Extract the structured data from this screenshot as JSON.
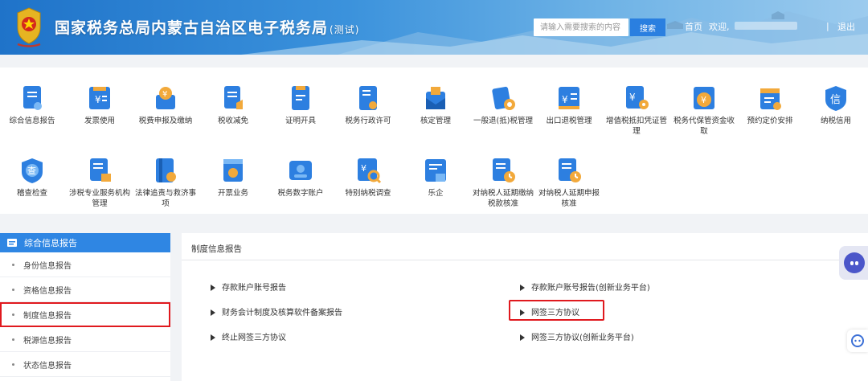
{
  "header": {
    "title": "国家税务总局内蒙古自治区电子税务局",
    "title_suffix": "(测试)",
    "search_placeholder": "请输入需要搜索的内容",
    "search_button": "搜索",
    "home_link": "首页",
    "welcome": "欢迎,",
    "separator": "|",
    "logout": "退出"
  },
  "nav_items": [
    {
      "label": "综合信息报告",
      "icon": "info-report-icon"
    },
    {
      "label": "发票使用",
      "icon": "invoice-icon"
    },
    {
      "label": "税费申报及缴纳",
      "icon": "tax-payment-icon"
    },
    {
      "label": "税收减免",
      "icon": "tax-relief-icon"
    },
    {
      "label": "证明开具",
      "icon": "certificate-icon"
    },
    {
      "label": "税务行政许可",
      "icon": "license-icon"
    },
    {
      "label": "核定管理",
      "icon": "assessment-icon"
    },
    {
      "label": "一般退(抵)税管理",
      "icon": "refund-icon"
    },
    {
      "label": "出口退税管理",
      "icon": "export-refund-icon"
    },
    {
      "label": "增值税抵扣凭证管理",
      "icon": "vat-deduction-icon"
    },
    {
      "label": "税务代保管资金收取",
      "icon": "custody-fund-icon"
    },
    {
      "label": "预约定价安排",
      "icon": "pricing-icon"
    },
    {
      "label": "纳税信用",
      "icon": "credit-icon"
    },
    {
      "label": "稽查检查",
      "icon": "inspection-icon"
    },
    {
      "label": "涉税专业服务机构管理",
      "icon": "agency-icon"
    },
    {
      "label": "法律追责与救济事项",
      "icon": "legal-icon"
    },
    {
      "label": "开票业务",
      "icon": "invoicing-icon"
    },
    {
      "label": "税务数字账户",
      "icon": "digital-account-icon"
    },
    {
      "label": "特别纳税调查",
      "icon": "special-investigation-icon"
    },
    {
      "label": "乐企",
      "icon": "enterprise-icon"
    },
    {
      "label": "对纳税人延期缴纳税款核准",
      "icon": "deferred-payment-icon"
    },
    {
      "label": "对纳税人延期申报核准",
      "icon": "deferred-filing-icon"
    }
  ],
  "sidebar": {
    "heading": "综合信息报告",
    "items": [
      {
        "label": "身份信息报告"
      },
      {
        "label": "资格信息报告"
      },
      {
        "label": "制度信息报告",
        "highlighted": true
      },
      {
        "label": "税源信息报告"
      },
      {
        "label": "状态信息报告"
      }
    ]
  },
  "content": {
    "title": "制度信息报告",
    "links": [
      {
        "label": "存款账户账号报告"
      },
      {
        "label": "存款账户账号报告(创新业务平台)"
      },
      {
        "label": "财务会计制度及核算软件备案报告"
      },
      {
        "label": "网签三方协议",
        "highlighted": true
      },
      {
        "label": "终止网签三方协议"
      },
      {
        "label": "网签三方协议(创新业务平台)"
      }
    ]
  },
  "colors": {
    "header_blue": "#1f73c9",
    "sidebar_active": "#2f86e3",
    "highlight_red": "#e0191e",
    "icon_blue": "#2d7fe0"
  }
}
